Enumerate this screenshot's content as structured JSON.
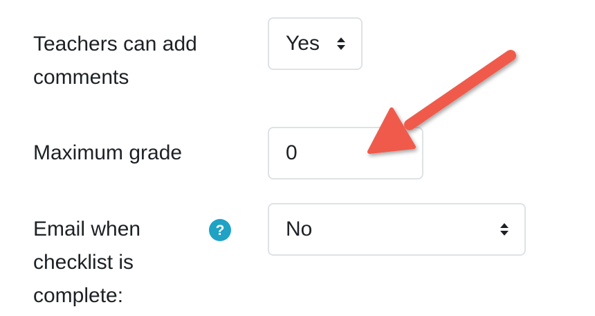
{
  "form": {
    "teacher_comments": {
      "label_line1": "Teachers can add",
      "label_line2": "comments",
      "selected": "Yes"
    },
    "max_grade": {
      "label": "Maximum grade",
      "value": "0"
    },
    "email_complete": {
      "label_line1": "Email when",
      "label_line2": "checklist is",
      "label_line3": "complete:",
      "help_glyph": "?",
      "selected": "No"
    }
  },
  "icons": {
    "help": "question-circle-icon",
    "select": "sort-arrows-icon",
    "annotation": "red-arrow-annotation"
  },
  "colors": {
    "help_icon": "#1fa2c4",
    "annotation_arrow": "#f05a4b",
    "border": "#dee2e6"
  }
}
